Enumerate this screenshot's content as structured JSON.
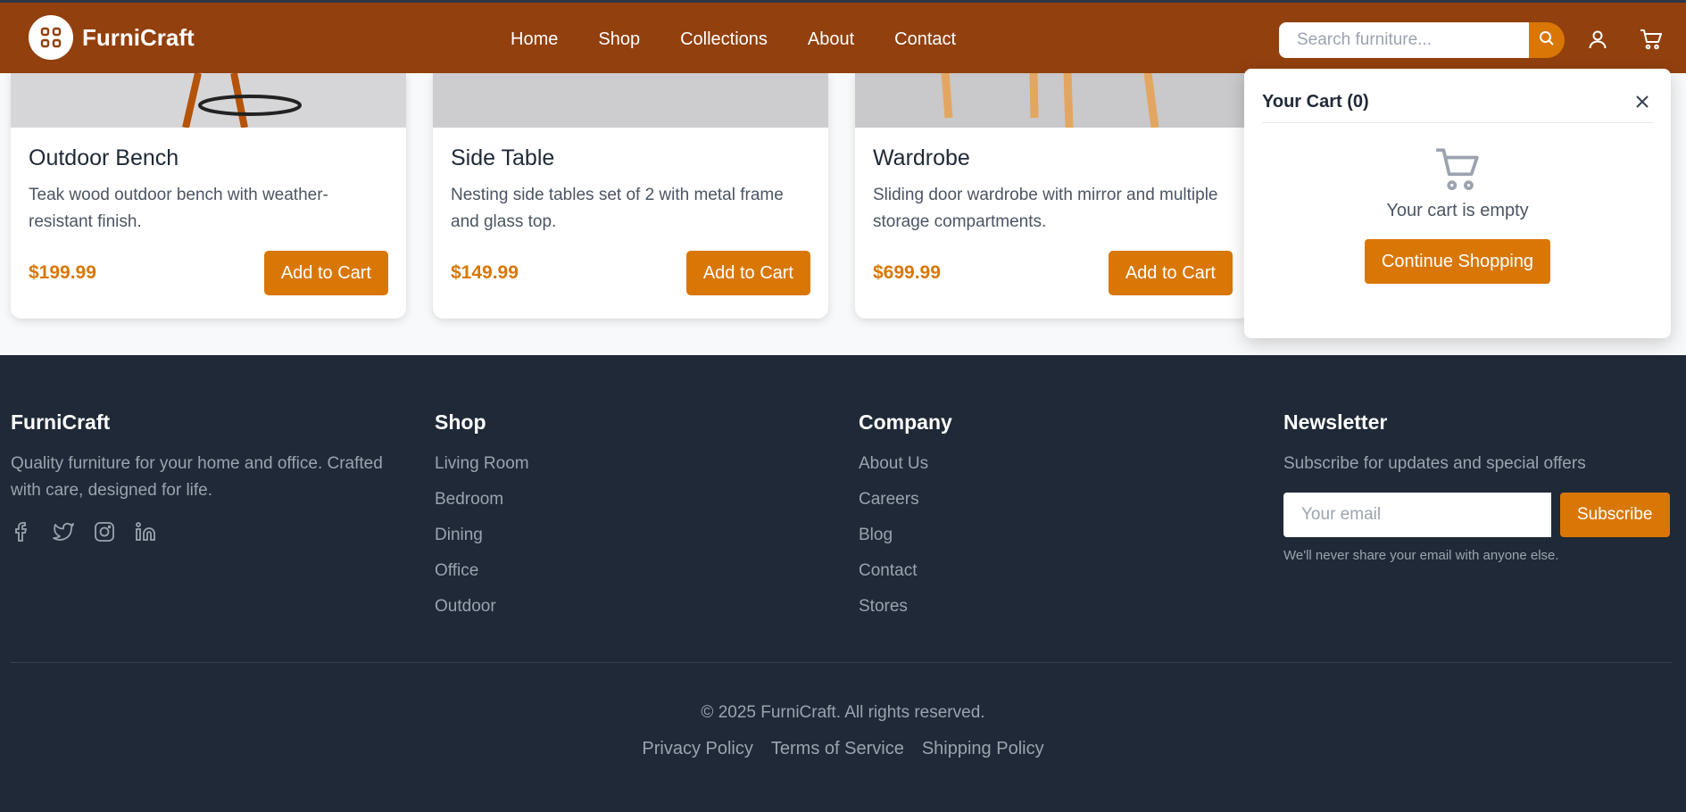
{
  "brand": {
    "name": "FurniCraft",
    "logo_icon": "grid-icon"
  },
  "nav": {
    "items": [
      {
        "label": "Home"
      },
      {
        "label": "Shop"
      },
      {
        "label": "Collections"
      },
      {
        "label": "About"
      },
      {
        "label": "Contact"
      }
    ]
  },
  "search": {
    "placeholder": "Search furniture...",
    "value": ""
  },
  "header_icons": [
    "search-icon",
    "user-icon",
    "cart-icon"
  ],
  "colors": {
    "header": "#92400e",
    "accent": "#d97706",
    "footer": "#1f2937"
  },
  "products": [
    {
      "title": "Outdoor Bench",
      "desc": "Teak wood outdoor bench with weather-resistant finish.",
      "price": "$199.99",
      "cta": "Add to Cart"
    },
    {
      "title": "Side Table",
      "desc": "Nesting side tables set of 2 with metal frame and glass top.",
      "price": "$149.99",
      "cta": "Add to Cart"
    },
    {
      "title": "Wardrobe",
      "desc": "Sliding door wardrobe with mirror and multiple storage compartments.",
      "price": "$699.99",
      "cta": "Add to Cart"
    }
  ],
  "cart": {
    "title": "Your Cart (0)",
    "empty_text": "Your cart is empty",
    "continue_label": "Continue Shopping"
  },
  "footer": {
    "brand": {
      "title": "FurniCraft",
      "text": "Quality furniture for your home and office. Crafted with care, designed for life.",
      "social": [
        "facebook-icon",
        "twitter-icon",
        "instagram-icon",
        "linkedin-icon"
      ]
    },
    "shop": {
      "title": "Shop",
      "links": [
        "Living Room",
        "Bedroom",
        "Dining",
        "Office",
        "Outdoor"
      ]
    },
    "company": {
      "title": "Company",
      "links": [
        "About Us",
        "Careers",
        "Blog",
        "Contact",
        "Stores"
      ]
    },
    "newsletter": {
      "title": "Newsletter",
      "text": "Subscribe for updates and special offers",
      "placeholder": "Your email",
      "button": "Subscribe",
      "note": "We'll never share your email with anyone else."
    },
    "copyright": "© 2025 FurniCraft. All rights reserved.",
    "legal": [
      "Privacy Policy",
      "Terms of Service",
      "Shipping Policy"
    ]
  }
}
